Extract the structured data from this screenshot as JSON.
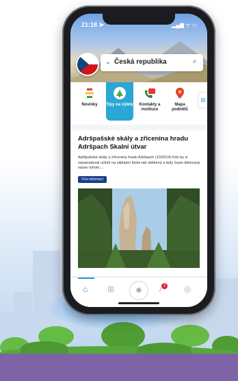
{
  "status_bar": {
    "time": "21:18 ➤",
    "icons": "▂▄▆ ᯤ ▭"
  },
  "region": {
    "value": "Česká republika"
  },
  "categories": [
    {
      "label": "Novinky",
      "icon": "news-icon"
    },
    {
      "label": "Tipy na výlety",
      "icon": "trip-tips-icon"
    },
    {
      "label": "Kontakty a instituce",
      "icon": "contacts-icon"
    },
    {
      "label": "Mapa podnětů",
      "icon": "map-pin-icon"
    }
  ],
  "article": {
    "title": "Adršpašské skály a zřícenina hradu Adršpach Skalní útvar",
    "excerpt": "Adršpašské skály a zřícenina hradu Adršpach (10/2014) Kdo by si nepamatoval učitelí na základní škole tak oblíbený a tedy často diktovaný název tohoto....",
    "button": "Více informací"
  },
  "tabbar": {
    "notification_count": "2"
  },
  "colors": {
    "accent": "#2aa7d4",
    "brand_dark": "#1a3f8a",
    "badge": "#d7263d"
  }
}
